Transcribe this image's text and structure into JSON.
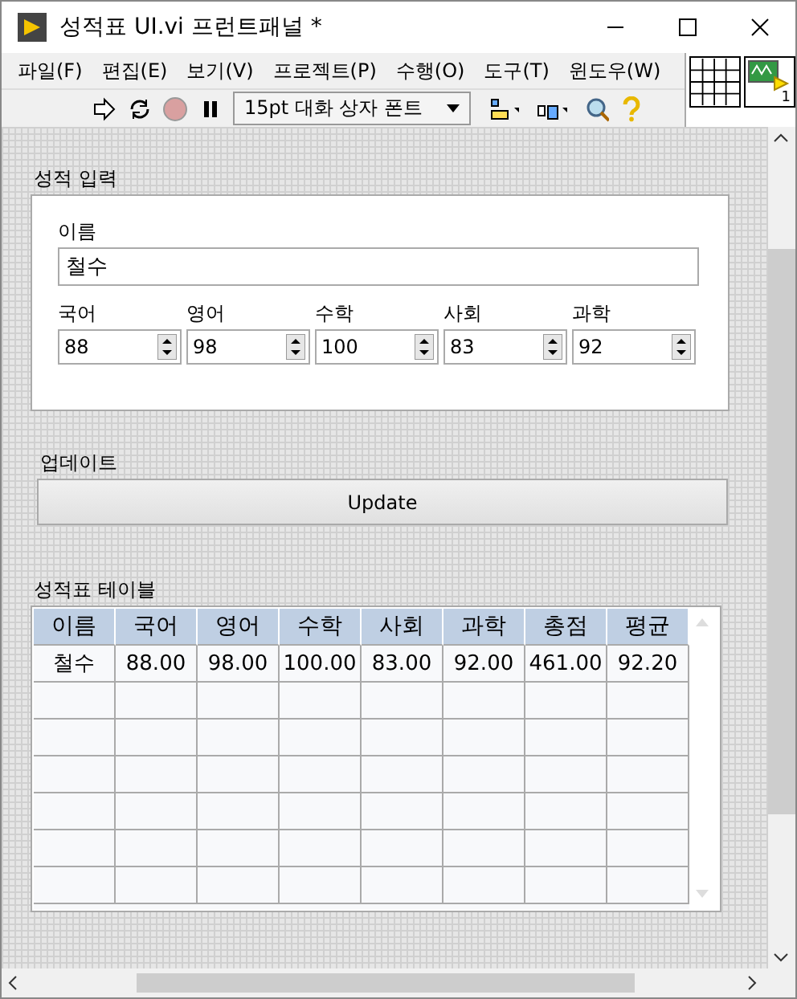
{
  "window": {
    "title": "성적표 UI.vi 프런트패널 *"
  },
  "menu": [
    "파일(F)",
    "편집(E)",
    "보기(V)",
    "프로젝트(P)",
    "수행(O)",
    "도구(T)",
    "윈도우(W)"
  ],
  "toolbar": {
    "font": "15pt 대화 상자 폰트"
  },
  "vi_icon": {
    "number": "1"
  },
  "input_section": {
    "label": "성적 입력",
    "name_label": "이름",
    "name_value": "철수",
    "scores": [
      {
        "label": "국어",
        "value": "88"
      },
      {
        "label": "영어",
        "value": "98"
      },
      {
        "label": "수학",
        "value": "100"
      },
      {
        "label": "사회",
        "value": "83"
      },
      {
        "label": "과학",
        "value": "92"
      }
    ]
  },
  "update": {
    "label": "업데이트",
    "button": "Update"
  },
  "table": {
    "label": "성적표 테이블",
    "columns": [
      "이름",
      "국어",
      "영어",
      "수학",
      "사회",
      "과학",
      "총점",
      "평균"
    ],
    "rows": [
      [
        "철수",
        "88.00",
        "98.00",
        "100.00",
        "83.00",
        "92.00",
        "461.00",
        "92.20"
      ]
    ]
  }
}
